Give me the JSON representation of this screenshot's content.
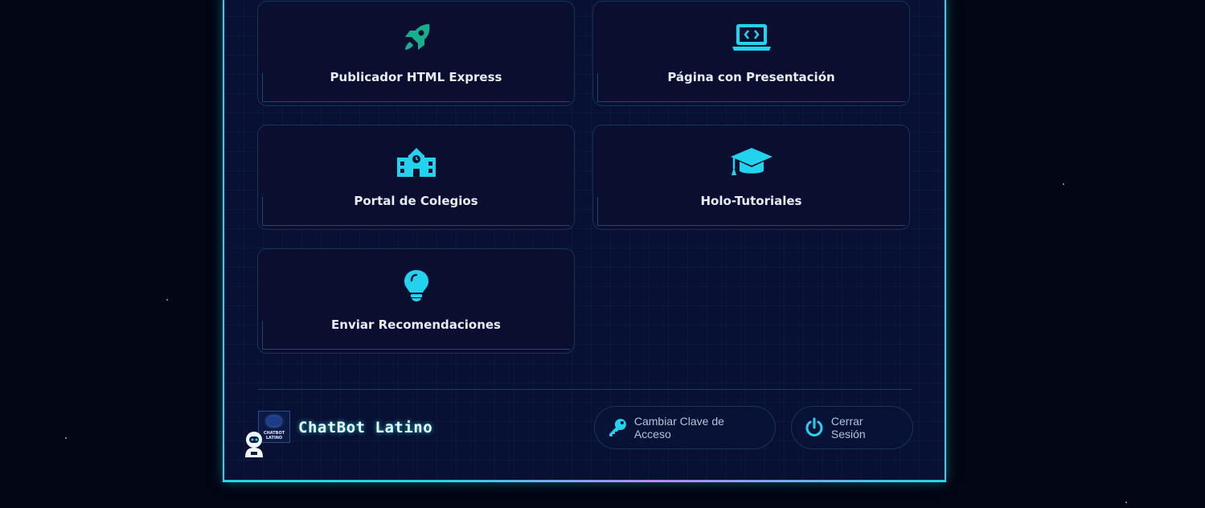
{
  "cards": [
    {
      "label": "Publicador HTML Express",
      "icon": "rocket-icon",
      "icon_color": "#16b08d"
    },
    {
      "label": "Página con Presentación",
      "icon": "laptop-code-icon",
      "icon_color": "#22d3ee"
    },
    {
      "label": "Portal de Colegios",
      "icon": "school-icon",
      "icon_color": "#22d3ee"
    },
    {
      "label": "Holo-Tutoriales",
      "icon": "graduation-cap-icon",
      "icon_color": "#22d3ee"
    },
    {
      "label": "Enviar Recomendaciones",
      "icon": "lightbulb-icon",
      "icon_color": "#22d3ee"
    }
  ],
  "footer": {
    "brand_name": "ChatBot Latino",
    "logo_text": "CHATBOT LATINO",
    "change_password_label": "Cambiar Clave de Acceso",
    "logout_label": "Cerrar Sesión"
  },
  "colors": {
    "accent": "#22d3ee",
    "panel_background": "#081033",
    "page_background": "#020513",
    "rocket": "#16b08d"
  }
}
